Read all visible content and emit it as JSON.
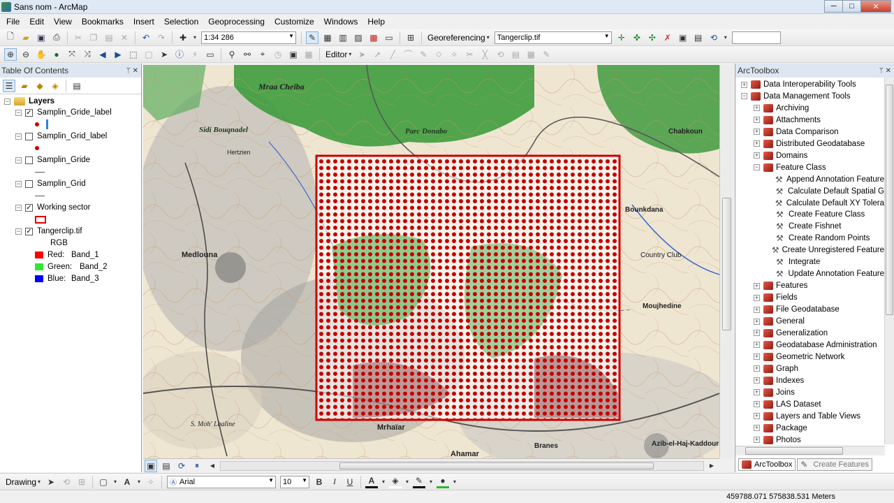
{
  "window": {
    "title": "Sans nom - ArcMap",
    "min": "─",
    "max": "□",
    "close": "✕"
  },
  "menu": [
    "File",
    "Edit",
    "View",
    "Bookmarks",
    "Insert",
    "Selection",
    "Geoprocessing",
    "Customize",
    "Windows",
    "Help"
  ],
  "toolbar": {
    "scale": "1:34 286",
    "georeferencing_label": "Georeferencing",
    "georef_layer": "Tangerclip.tif",
    "editor_label": "Editor"
  },
  "toc": {
    "title": "Table Of Contents",
    "root": "Layers",
    "layers": [
      {
        "name": "Samplin_Gride_label",
        "checked": true
      },
      {
        "name": "Samplin_Grid_label",
        "checked": false
      },
      {
        "name": "Samplin_Gride",
        "checked": false
      },
      {
        "name": "Samplin_Grid",
        "checked": false
      },
      {
        "name": "Working sector",
        "checked": true
      },
      {
        "name": "Tangerclip.tif",
        "checked": true
      }
    ],
    "rgb_label": "RGB",
    "bands": [
      {
        "label": "Red:",
        "band": "Band_1",
        "color": "#ff0000"
      },
      {
        "label": "Green:",
        "band": "Band_2",
        "color": "#33e633"
      },
      {
        "label": "Blue:",
        "band": "Band_3",
        "color": "#0000ff"
      }
    ]
  },
  "map": {
    "labels": [
      "Mraa Cheiba",
      "Medlouna",
      "Azib-el-Haj-Kaddour",
      "Mrhaïar",
      "Ahamar",
      "Country Club",
      "Moujhedine",
      "S. Moh' Lbaline",
      "Branes",
      "Parc Donabo",
      "Sidi Bouqnadel",
      "Bounkdana",
      "Chabkoun",
      "Hertzien"
    ],
    "grid_color": "#cc0000",
    "dot_color": "#c40000"
  },
  "arctoolbox": {
    "title": "ArcToolbox",
    "items": [
      {
        "label": "Data Interoperability Tools",
        "level": 0,
        "exp": "+",
        "kind": "toolbox"
      },
      {
        "label": "Data Management Tools",
        "level": 0,
        "exp": "−",
        "kind": "toolbox"
      },
      {
        "label": "Archiving",
        "level": 1,
        "exp": "+",
        "kind": "toolbox"
      },
      {
        "label": "Attachments",
        "level": 1,
        "exp": "+",
        "kind": "toolbox"
      },
      {
        "label": "Data Comparison",
        "level": 1,
        "exp": "+",
        "kind": "toolbox"
      },
      {
        "label": "Distributed Geodatabase",
        "level": 1,
        "exp": "+",
        "kind": "toolbox"
      },
      {
        "label": "Domains",
        "level": 1,
        "exp": "+",
        "kind": "toolbox"
      },
      {
        "label": "Feature Class",
        "level": 1,
        "exp": "−",
        "kind": "toolbox"
      },
      {
        "label": "Append Annotation Feature",
        "level": 2,
        "exp": "",
        "kind": "tool"
      },
      {
        "label": "Calculate Default Spatial G",
        "level": 2,
        "exp": "",
        "kind": "tool"
      },
      {
        "label": "Calculate Default XY Tolera",
        "level": 2,
        "exp": "",
        "kind": "tool"
      },
      {
        "label": "Create Feature Class",
        "level": 2,
        "exp": "",
        "kind": "tool"
      },
      {
        "label": "Create Fishnet",
        "level": 2,
        "exp": "",
        "kind": "tool"
      },
      {
        "label": "Create Random Points",
        "level": 2,
        "exp": "",
        "kind": "tool"
      },
      {
        "label": "Create Unregistered Feature",
        "level": 2,
        "exp": "",
        "kind": "tool"
      },
      {
        "label": "Integrate",
        "level": 2,
        "exp": "",
        "kind": "tool"
      },
      {
        "label": "Update Annotation Feature",
        "level": 2,
        "exp": "",
        "kind": "tool"
      },
      {
        "label": "Features",
        "level": 1,
        "exp": "+",
        "kind": "toolbox"
      },
      {
        "label": "Fields",
        "level": 1,
        "exp": "+",
        "kind": "toolbox"
      },
      {
        "label": "File Geodatabase",
        "level": 1,
        "exp": "+",
        "kind": "toolbox"
      },
      {
        "label": "General",
        "level": 1,
        "exp": "+",
        "kind": "toolbox"
      },
      {
        "label": "Generalization",
        "level": 1,
        "exp": "+",
        "kind": "toolbox"
      },
      {
        "label": "Geodatabase Administration",
        "level": 1,
        "exp": "+",
        "kind": "toolbox"
      },
      {
        "label": "Geometric Network",
        "level": 1,
        "exp": "+",
        "kind": "toolbox"
      },
      {
        "label": "Graph",
        "level": 1,
        "exp": "+",
        "kind": "toolbox"
      },
      {
        "label": "Indexes",
        "level": 1,
        "exp": "+",
        "kind": "toolbox"
      },
      {
        "label": "Joins",
        "level": 1,
        "exp": "+",
        "kind": "toolbox"
      },
      {
        "label": "LAS Dataset",
        "level": 1,
        "exp": "+",
        "kind": "toolbox"
      },
      {
        "label": "Layers and Table Views",
        "level": 1,
        "exp": "+",
        "kind": "toolbox"
      },
      {
        "label": "Package",
        "level": 1,
        "exp": "+",
        "kind": "toolbox"
      },
      {
        "label": "Photos",
        "level": 1,
        "exp": "+",
        "kind": "toolbox"
      }
    ],
    "tabs": [
      "ArcToolbox",
      "Create Features"
    ]
  },
  "drawing": {
    "label": "Drawing",
    "font": "Arial",
    "size": "10",
    "bold": "B",
    "italic": "I",
    "underline": "U",
    "font_color": "A"
  },
  "status": {
    "coords": "459788.071  575838.531 Meters"
  }
}
